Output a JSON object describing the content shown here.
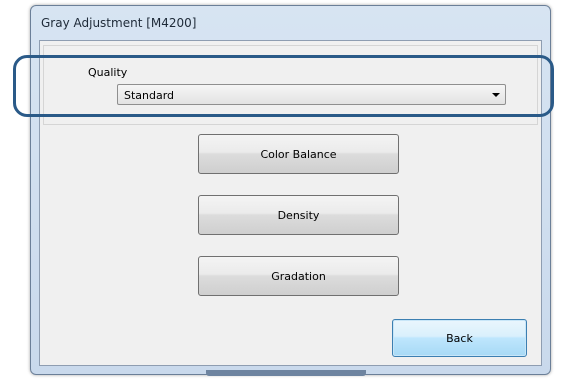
{
  "window": {
    "title": "Gray Adjustment [M4200]"
  },
  "quality": {
    "label": "Quality",
    "selected": "Standard"
  },
  "buttons": {
    "color_balance": "Color Balance",
    "density": "Density",
    "gradation": "Gradation",
    "back": "Back"
  },
  "colors": {
    "highlight": "#2a5a88",
    "window_frame": "#c9d9ec",
    "client_bg": "#f0f0f0"
  }
}
